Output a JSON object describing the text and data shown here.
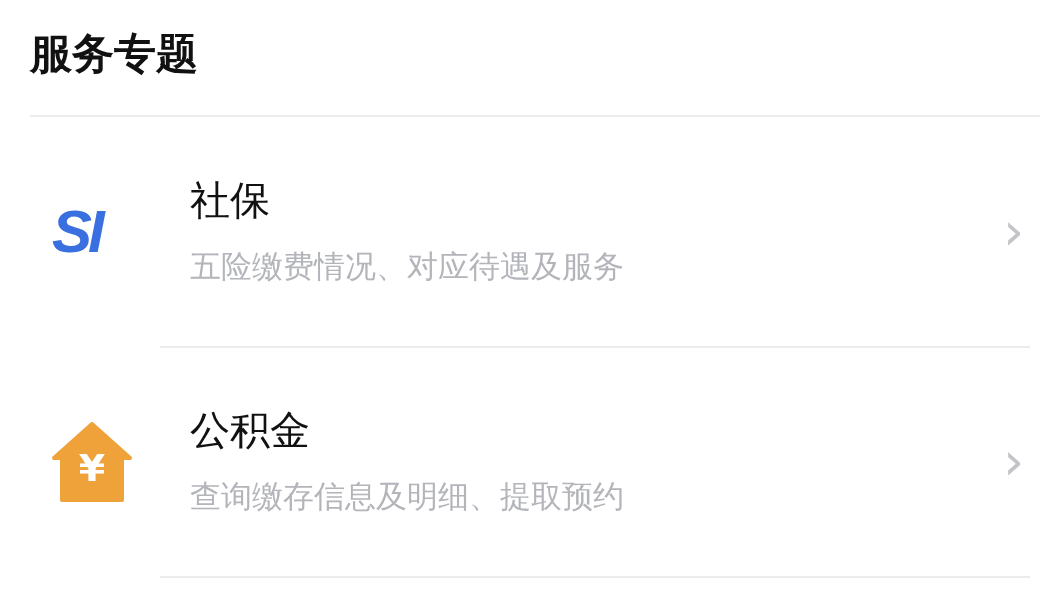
{
  "section": {
    "title": "服务专题"
  },
  "items": [
    {
      "kind": "si",
      "icon_text": "SI",
      "title": "社保",
      "subtitle": "五险缴费情况、对应待遇及服务",
      "chevron": "›"
    },
    {
      "kind": "house",
      "icon_text": "¥",
      "title": "公积金",
      "subtitle": "查询缴存信息及明细、提取预约",
      "chevron": "›"
    }
  ]
}
